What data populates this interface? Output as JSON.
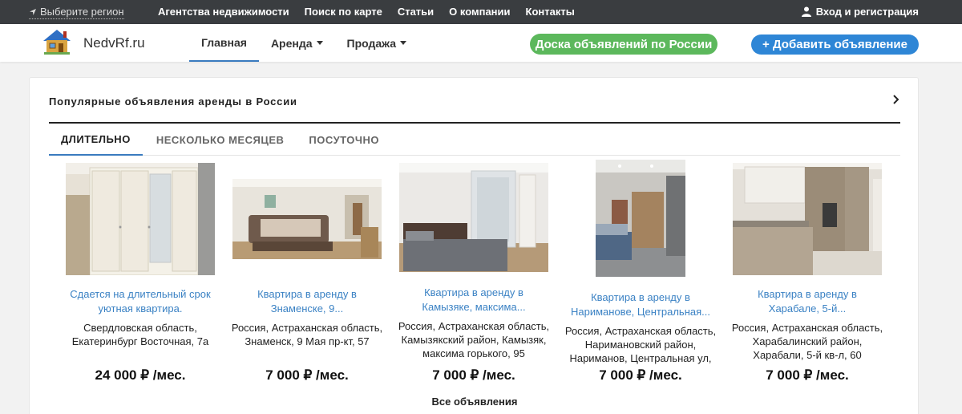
{
  "topbar": {
    "region": "Выберите регион",
    "nav": [
      "Агентства недвижимости",
      "Поиск по карте",
      "Статьи",
      "О компании",
      "Контакты"
    ],
    "login": "Вход и регистрация"
  },
  "header": {
    "brand": "NedvRf.ru",
    "nav": [
      {
        "label": "Главная"
      },
      {
        "label": "Аренда"
      },
      {
        "label": "Продажа"
      }
    ],
    "board_button": "Доска объявлений по России",
    "add_button": "+ Добавить объявление"
  },
  "section": {
    "title": "Популярные объявления аренды в России",
    "tabs": [
      "ДЛИТЕЛЬНО",
      "НЕСКОЛЬКО МЕСЯЦЕВ",
      "ПОСУТОЧНО"
    ],
    "all_link": "Все объявления"
  },
  "listings": [
    {
      "title_line1": "Сдается на длительный срок",
      "title_line2": "уютная квартира.",
      "address_lines": [
        "Свердловская область,",
        "Екатеринбург Восточная, 7а"
      ],
      "price": "24 000 ₽ /мес."
    },
    {
      "title_line1": "Квартира в аренду в",
      "title_line2": "Знаменске, 9...",
      "address_lines": [
        "Россия, Астраханская область,",
        "Знаменск, 9 Мая пр-кт, 57"
      ],
      "price": "7 000 ₽ /мес."
    },
    {
      "title_line1": "Квартира в аренду в",
      "title_line2": "Камызяке, максима...",
      "address_lines": [
        "Россия, Астраханская область,",
        "Камызякский район, Камызяк,",
        "максима горького, 95"
      ],
      "price": "7 000 ₽ /мес."
    },
    {
      "title_line1": "Квартира в аренду в",
      "title_line2": "Нариманове, Центральная...",
      "address_lines": [
        "Россия, Астраханская область,",
        "Наримановский район,",
        "Нариманов, Центральная ул,"
      ],
      "price": "7 000 ₽ /мес."
    },
    {
      "title_line1": "Квартира в аренду в",
      "title_line2": "Харабале, 5-й...",
      "address_lines": [
        "Россия, Астраханская область,",
        "Харабалинский район,",
        "Харабали, 5-й кв-л, 60"
      ],
      "price": "7 000 ₽ /мес."
    }
  ],
  "colors": {
    "topbar": "#3a3d40",
    "link": "#3b82c4",
    "green_button": "#5cb85c",
    "blue_button": "#2e86d6",
    "active_tab_underline": "#3a7bbf"
  }
}
